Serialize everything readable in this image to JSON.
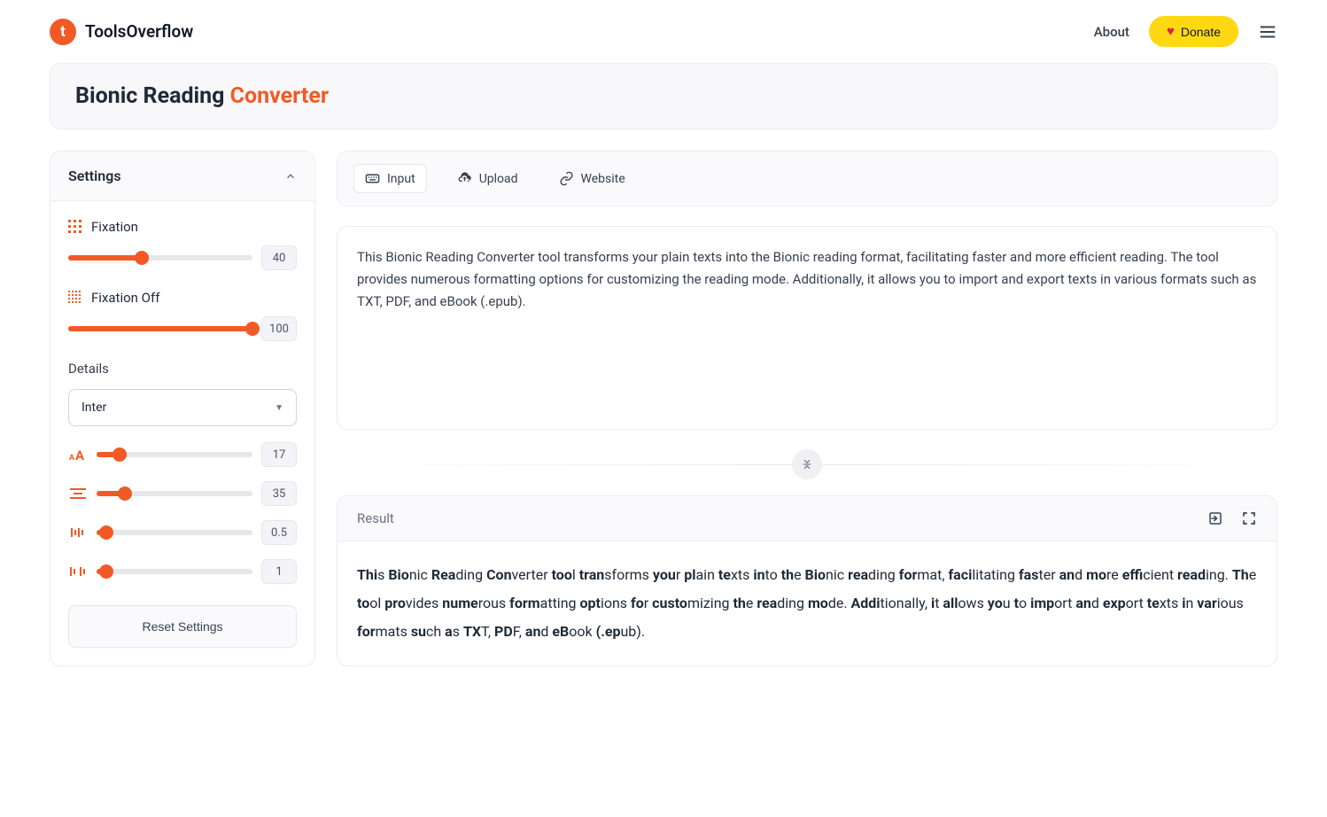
{
  "header": {
    "brand": "ToolsOverflow",
    "about": "About",
    "donate": "Donate"
  },
  "title": {
    "prefix": "Bionic Reading ",
    "accent": "Converter"
  },
  "sidebar": {
    "heading": "Settings",
    "fixation": {
      "label": "Fixation",
      "value": "40",
      "percent": 40
    },
    "fixation_off": {
      "label": "Fixation Off",
      "value": "100",
      "percent": 100
    },
    "details_label": "Details",
    "font": "Inter",
    "font_size": {
      "value": "17",
      "percent": 15
    },
    "line_height": {
      "value": "35",
      "percent": 18
    },
    "letter_spacing": {
      "value": "0.5",
      "percent": 6
    },
    "word_spacing": {
      "value": "1",
      "percent": 6
    },
    "reset": "Reset Settings"
  },
  "tabs": {
    "input": "Input",
    "upload": "Upload",
    "website": "Website"
  },
  "input_text": "This Bionic Reading Converter tool transforms your plain texts into the Bionic reading format, facilitating faster and more efficient reading. The tool provides numerous formatting options for customizing the reading mode. Additionally, it allows you to import and export texts in various formats such as TXT, PDF, and eBook (.epub).",
  "result": {
    "heading": "Result"
  }
}
